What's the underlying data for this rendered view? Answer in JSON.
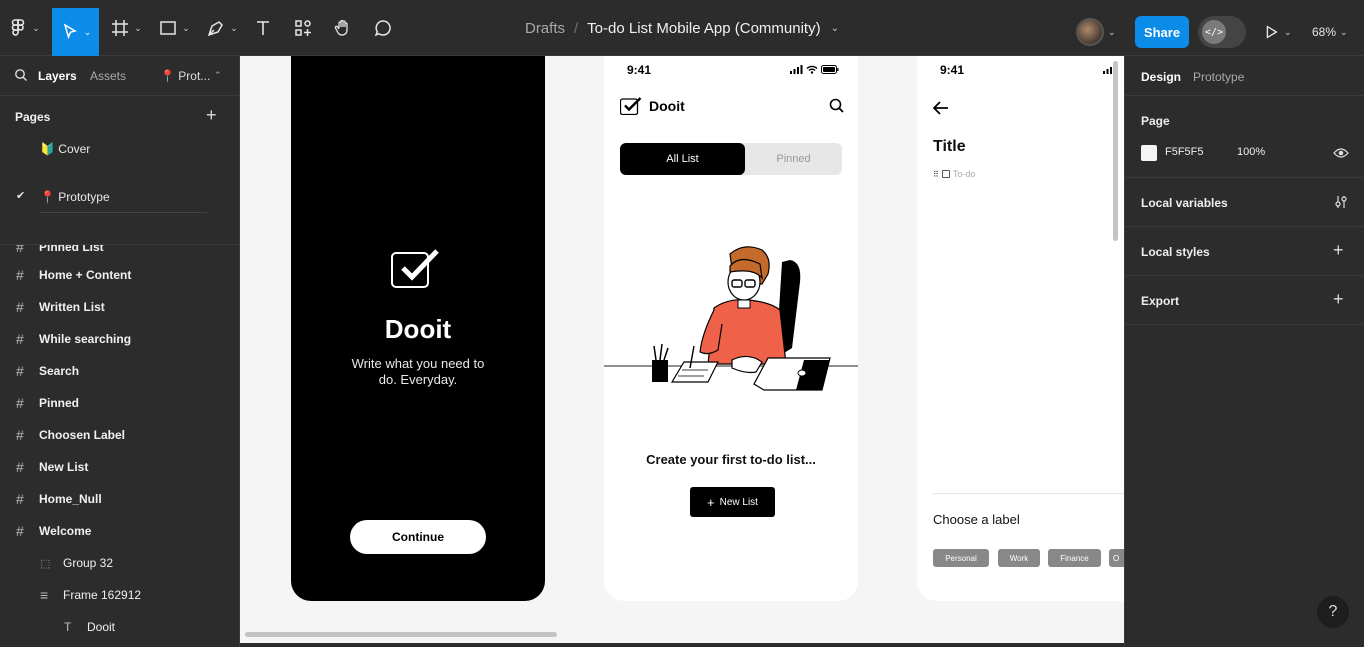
{
  "toolbar": {
    "file_breadcrumb": "Drafts",
    "file_separator": "/",
    "file_name": "To-do List Mobile App (Community)",
    "share_label": "Share",
    "devmode_glyph": "</>",
    "zoom_label": "68%"
  },
  "left_panel": {
    "tabs": {
      "layers": "Layers",
      "assets": "Assets",
      "page_pill": "📍 Prot..."
    },
    "pages_header": "Pages",
    "pages": [
      {
        "label": "🔰 Cover",
        "current": false
      },
      {
        "label": "📍 Prototype",
        "current": true
      }
    ],
    "layers": [
      "Pinned List",
      "Home + Content",
      "Written List",
      "While searching",
      "Search",
      "Pinned",
      "Choosen Label",
      "New List",
      "Home_Null",
      "Welcome"
    ],
    "layers_nested": [
      {
        "label": "Group 32",
        "icon": "group-icon"
      },
      {
        "label": "Frame 162912",
        "icon": "autolayout-icon"
      },
      {
        "label": "Dooit",
        "icon": "text-icon"
      }
    ]
  },
  "canvas": {
    "welcome": {
      "title": "Dooit",
      "subtitle": "Write what you need to do. Everyday.",
      "button": "Continue"
    },
    "home": {
      "time": "9:41",
      "app_name": "Dooit",
      "tab_all": "All List",
      "tab_pinned": "Pinned",
      "empty_text": "Create your first to-do list...",
      "new_button": "New List"
    },
    "new_list": {
      "time": "9:41",
      "title": "Title",
      "todo_placeholder": "To-do",
      "label_header": "Choose a label",
      "chips": [
        "Personal",
        "Work",
        "Finance",
        "O"
      ]
    }
  },
  "right_panel": {
    "tab_design": "Design",
    "tab_prototype": "Prototype",
    "page_header": "Page",
    "page_color": "F5F5F5",
    "page_opacity": "100%",
    "sections": [
      "Local variables",
      "Local styles",
      "Export"
    ]
  },
  "colors": {
    "accent": "#0c8ce9",
    "panel": "#2c2c2c",
    "canvas": "#f5f5f5",
    "illustration_shirt": "#f0614a"
  },
  "help_glyph": "?"
}
